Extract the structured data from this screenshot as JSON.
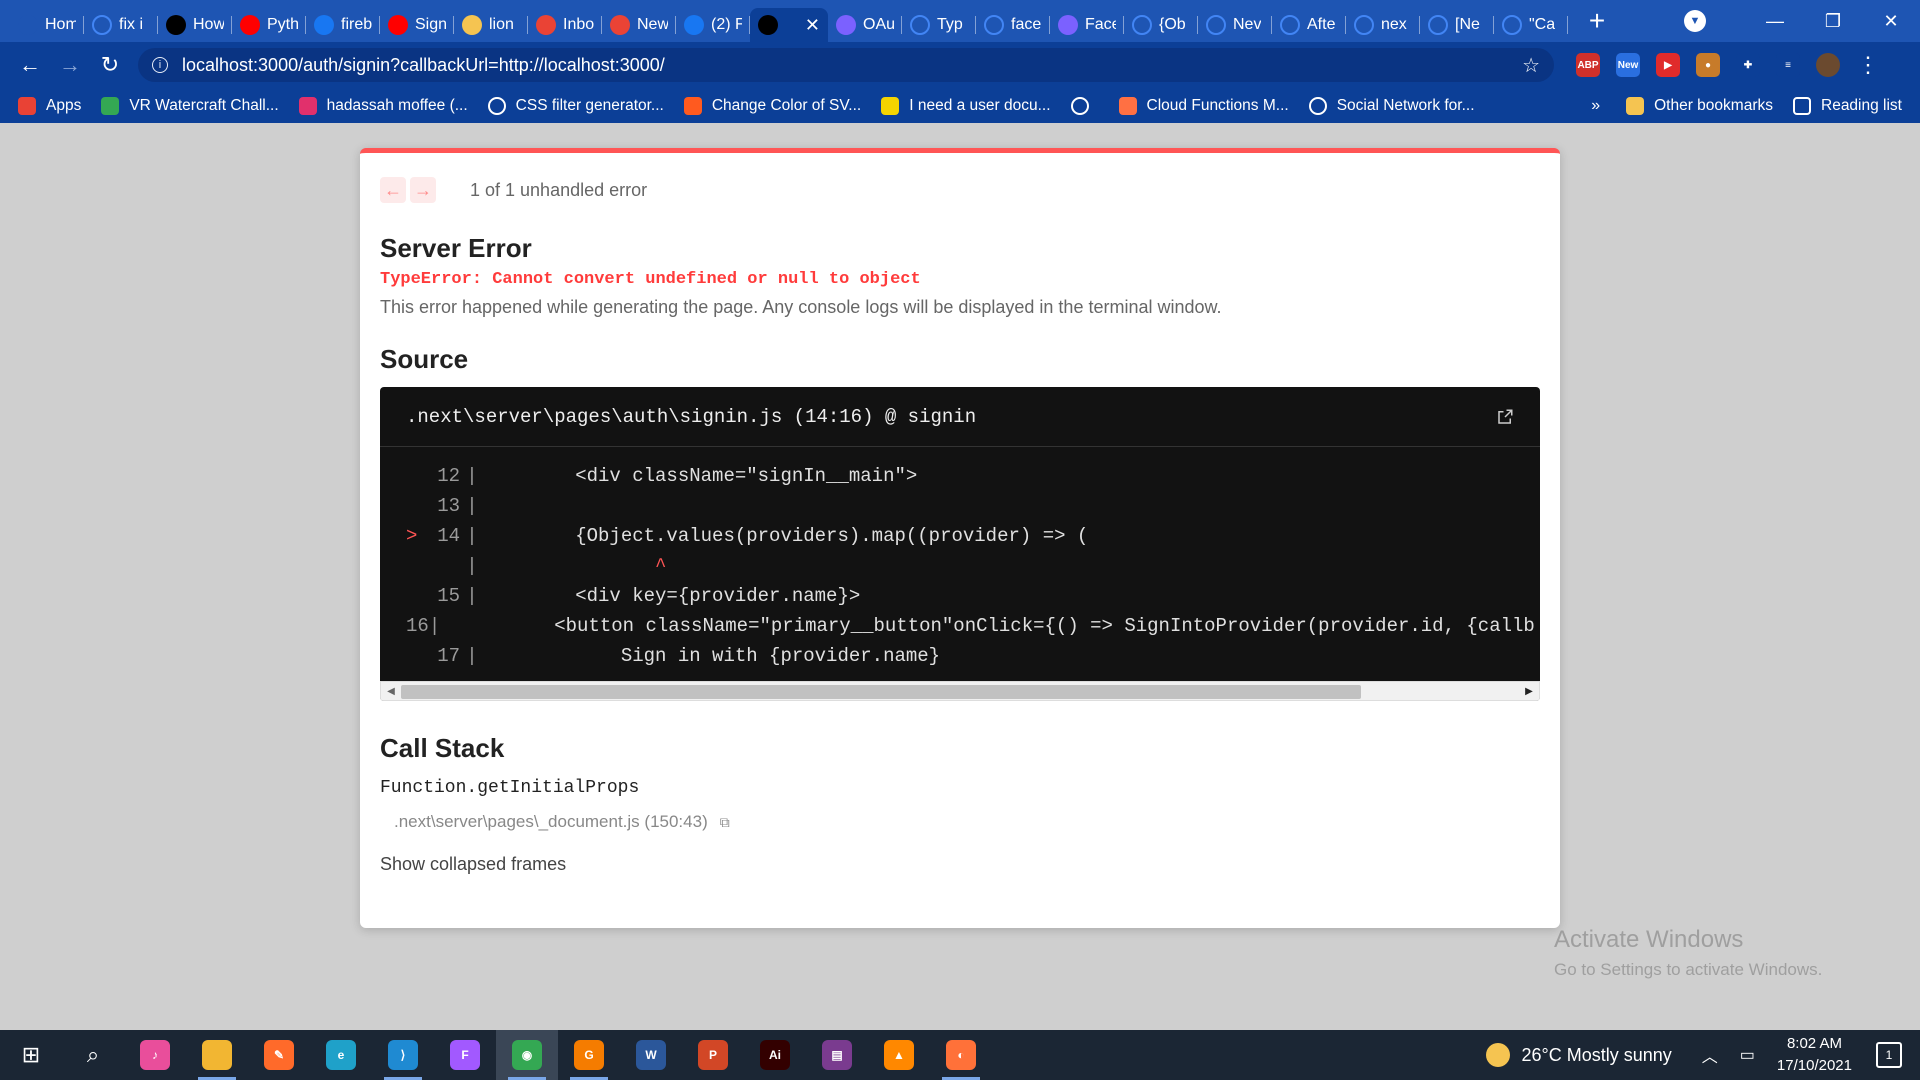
{
  "browser": {
    "tabs": [
      {
        "title": "Hom",
        "icon": "react-icon",
        "color": "#1e55b3"
      },
      {
        "title": "fix i",
        "icon": "google-icon",
        "color": "#ffffff"
      },
      {
        "title": "How",
        "icon": "medium-icon",
        "color": "#000000"
      },
      {
        "title": "Pyth",
        "icon": "youtube-icon",
        "color": "#ff0000"
      },
      {
        "title": "fireb",
        "icon": "facebook-icon",
        "color": "#1877f2"
      },
      {
        "title": "Sign",
        "icon": "youtube-icon",
        "color": "#ff0000"
      },
      {
        "title": "lion",
        "icon": "hand-icon",
        "color": "#f5c451"
      },
      {
        "title": "Inbo",
        "icon": "gmail-icon",
        "color": "#ea4335"
      },
      {
        "title": "New",
        "icon": "gmail-icon",
        "color": "#ea4335"
      },
      {
        "title": "(2) F",
        "icon": "facebook-icon",
        "color": "#1877f2"
      },
      {
        "title": "",
        "icon": "vercel-icon",
        "color": "#000000",
        "active": true
      },
      {
        "title": "OAu",
        "icon": "shield-icon",
        "color": "#7b61ff"
      },
      {
        "title": "Typ",
        "icon": "google-icon",
        "color": "#ffffff"
      },
      {
        "title": "face",
        "icon": "google-icon",
        "color": "#ffffff"
      },
      {
        "title": "Face",
        "icon": "shield-icon",
        "color": "#7b61ff"
      },
      {
        "title": "{Ob",
        "icon": "google-icon",
        "color": "#ffffff"
      },
      {
        "title": "Nev",
        "icon": "github-icon",
        "color": "#ffffff"
      },
      {
        "title": "Afte",
        "icon": "github-icon",
        "color": "#ffffff"
      },
      {
        "title": "nex",
        "icon": "github-icon",
        "color": "#ffffff"
      },
      {
        "title": "[Ne",
        "icon": "github-icon",
        "color": "#ffffff"
      },
      {
        "title": "\"Ca",
        "icon": "github-icon",
        "color": "#ffffff"
      }
    ],
    "url": "localhost:3000/auth/signin?callbackUrl=http://localhost:3000/",
    "extensions": [
      {
        "name": "abp-icon",
        "label": "ABP",
        "color": "#d0302b"
      },
      {
        "name": "new-extension-icon",
        "label": "New",
        "color": "#2a6fe0"
      },
      {
        "name": "video-icon",
        "label": "▶",
        "color": "#e02b2b"
      },
      {
        "name": "cookie-icon",
        "label": "●",
        "color": "#c77b2a"
      },
      {
        "name": "puzzle-icon",
        "label": "✚",
        "color": "#0c3f97"
      },
      {
        "name": "media-icon",
        "label": "≡",
        "color": "#0c3f97"
      },
      {
        "name": "profile-avatar-icon",
        "label": "",
        "color": "#6b4a2f"
      }
    ],
    "bookmarks": [
      {
        "label": "Apps",
        "color": "#e94235"
      },
      {
        "label": "VR Watercraft Chall...",
        "color": "#34a853"
      },
      {
        "label": "hadassah moffee (...",
        "color": "#e1306c"
      },
      {
        "label": "CSS filter generator...",
        "color": "#ffffff"
      },
      {
        "label": "Change Color of SV...",
        "color": "#ff5a1f"
      },
      {
        "label": "I need a user docu...",
        "color": "#f5d400"
      },
      {
        "label": "",
        "color": "#ffffff"
      },
      {
        "label": "Cloud Functions M...",
        "color": "#ff7043"
      },
      {
        "label": "Social Network for...",
        "color": "#ffffff"
      }
    ],
    "other_bookmarks": "Other bookmarks",
    "reading_list": "Reading list"
  },
  "overlay": {
    "pager_text": "1 of 1 unhandled error",
    "title": "Server Error",
    "error_message": "TypeError: Cannot convert undefined or null to object",
    "description": "This error happened while generating the page. Any console logs will be displayed in the terminal window.",
    "source_heading": "Source",
    "source_file": ".next\\server\\pages\\auth\\signin.js (14:16) @ signin",
    "code_lines": [
      {
        "marker": "",
        "num": "12",
        "code": "        <div className=\"signIn__main\">"
      },
      {
        "marker": "",
        "num": "13",
        "code": ""
      },
      {
        "marker": ">",
        "num": "14",
        "code": "        {Object.values(providers).map((provider) => ("
      },
      {
        "marker": "",
        "num": "",
        "code": "               ^",
        "caret": true
      },
      {
        "marker": "",
        "num": "15",
        "code": "        <div key={provider.name}>"
      },
      {
        "marker": "",
        "num": "16",
        "code": "          <button className=\"primary__button\"onClick={() => SignIntoProvider(provider.id, {callb"
      },
      {
        "marker": "",
        "num": "17",
        "code": "            Sign in with {provider.name}"
      }
    ],
    "call_stack_heading": "Call Stack",
    "frame_function": "Function.getInitialProps",
    "frame_file": ".next\\server\\pages\\_document.js (150:43)",
    "show_collapsed": "Show collapsed frames"
  },
  "watermark": {
    "line1": "Activate Windows",
    "line2": "Go to Settings to activate Windows."
  },
  "taskbar": {
    "apps": [
      {
        "name": "windows-start-icon",
        "label": "⊞",
        "color": "transparent"
      },
      {
        "name": "search-icon",
        "label": "⌕",
        "color": "transparent"
      },
      {
        "name": "itunes-icon",
        "label": "♪",
        "color": "#e94e9b"
      },
      {
        "name": "file-explorer-icon",
        "label": "",
        "color": "#f2b632"
      },
      {
        "name": "pen-app-icon",
        "label": "✎",
        "color": "#ff6a2a"
      },
      {
        "name": "edge-icon",
        "label": "e",
        "color": "#1fa1c9"
      },
      {
        "name": "vscode-icon",
        "label": "⟩",
        "color": "#1f8ad2"
      },
      {
        "name": "figma-icon",
        "label": "F",
        "color": "#a259ff"
      },
      {
        "name": "chrome-icon",
        "label": "◉",
        "color": "#34a853"
      },
      {
        "name": "pdf-app-icon",
        "label": "G",
        "color": "#f57c00"
      },
      {
        "name": "word-icon",
        "label": "W",
        "color": "#2b579a"
      },
      {
        "name": "powerpoint-icon",
        "label": "P",
        "color": "#d24726"
      },
      {
        "name": "illustrator-icon",
        "label": "Ai",
        "color": "#330000"
      },
      {
        "name": "winrar-icon",
        "label": "▤",
        "color": "#7a3b8f"
      },
      {
        "name": "vlc-icon",
        "label": "▲",
        "color": "#ff8800"
      },
      {
        "name": "firefox-icon",
        "label": "◐",
        "color": "#ff7139"
      }
    ],
    "weather": "26°C  Mostly sunny",
    "time": "8:02 AM",
    "date": "17/10/2021",
    "notifications": "1"
  }
}
